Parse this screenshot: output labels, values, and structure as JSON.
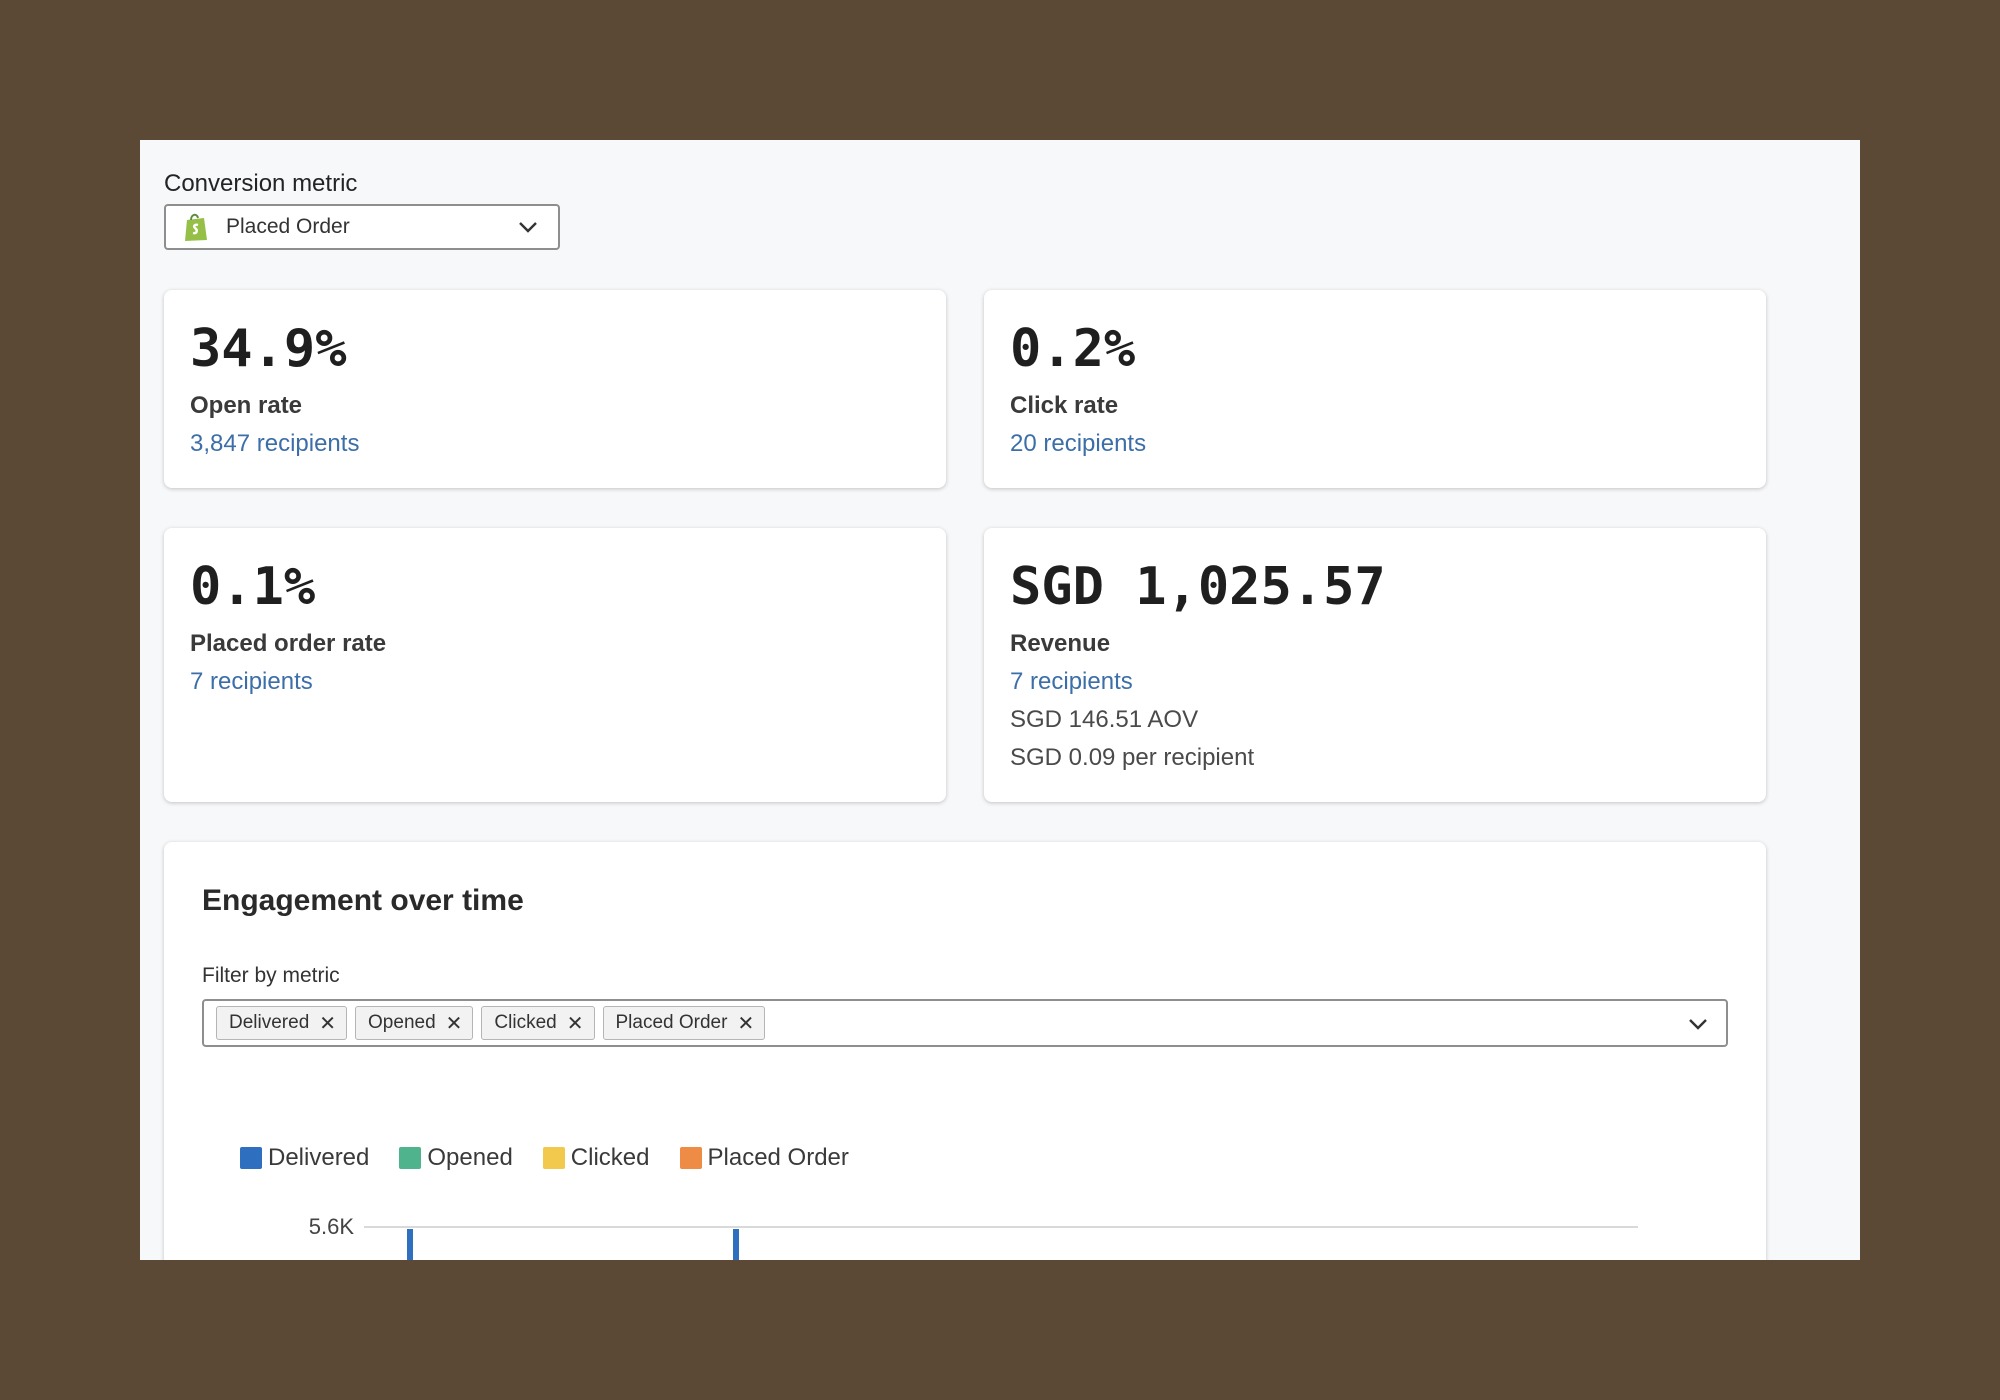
{
  "conversion": {
    "label": "Conversion metric",
    "selected": "Placed Order"
  },
  "cards": {
    "open": {
      "value": "34.9%",
      "title": "Open rate",
      "recipients": "3,847 recipients"
    },
    "click": {
      "value": "0.2%",
      "title": "Click rate",
      "recipients": "20 recipients"
    },
    "placed": {
      "value": "0.1%",
      "title": "Placed order rate",
      "recipients": "7 recipients"
    },
    "revenue": {
      "value": "SGD 1,025.57",
      "title": "Revenue",
      "recipients": "7 recipients",
      "aov": "SGD 146.51 AOV",
      "per_recipient": "SGD 0.09 per recipient"
    }
  },
  "engagement": {
    "title": "Engagement over time",
    "filter_label": "Filter by metric",
    "chips": [
      "Delivered",
      "Opened",
      "Clicked",
      "Placed Order"
    ]
  },
  "colors": {
    "link": "#3c6ea8",
    "delivered": "#2f6fbf",
    "opened": "#4fb48d",
    "clicked": "#f2c94c",
    "placed": "#ee8b45"
  },
  "chart_data": {
    "type": "bar",
    "series": [
      {
        "name": "Delivered",
        "color": "#2f6fbf"
      },
      {
        "name": "Opened",
        "color": "#4fb48d"
      },
      {
        "name": "Clicked",
        "color": "#f2c94c"
      },
      {
        "name": "Placed Order",
        "color": "#ee8b45"
      }
    ],
    "y_ticks": [
      "5.6K"
    ],
    "ylim": [
      0,
      5600
    ],
    "visible_bars": [
      {
        "series": "Delivered",
        "value": 5600
      },
      {
        "series": "Delivered",
        "value": 5600
      }
    ],
    "grid": true,
    "legend": "top-left"
  }
}
